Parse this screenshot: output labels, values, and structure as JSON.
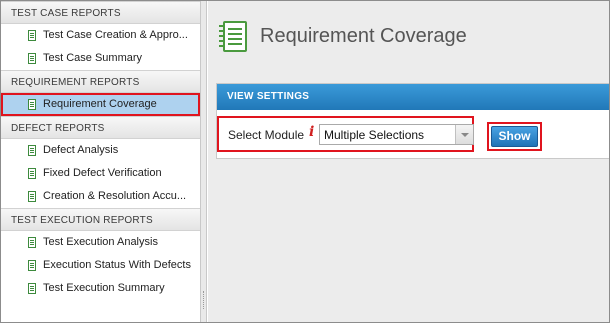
{
  "sidebar": {
    "sections": [
      {
        "title": "TEST CASE REPORTS",
        "items": [
          {
            "label": "Test Case Creation & Appro..."
          },
          {
            "label": "Test Case Summary"
          }
        ]
      },
      {
        "title": "REQUIREMENT REPORTS",
        "items": [
          {
            "label": "Requirement Coverage",
            "selected": true
          }
        ]
      },
      {
        "title": "DEFECT REPORTS",
        "items": [
          {
            "label": "Defect Analysis"
          },
          {
            "label": "Fixed Defect Verification"
          },
          {
            "label": "Creation & Resolution Accu..."
          }
        ]
      },
      {
        "title": "TEST EXECUTION REPORTS",
        "items": [
          {
            "label": "Test Execution Analysis"
          },
          {
            "label": "Execution Status With Defects"
          },
          {
            "label": "Test Execution Summary"
          }
        ]
      }
    ]
  },
  "main": {
    "page_title": "Requirement Coverage",
    "title_icon": "document-report-icon",
    "view_settings": {
      "header": "VIEW SETTINGS",
      "module_label": "Select Module",
      "required_marker": "i",
      "module_value": "Multiple Selections",
      "show_label": "Show"
    }
  },
  "colors": {
    "accent_blue": "#2a86c8",
    "highlight_red": "#e0141e",
    "selected_bg": "#aed2ef",
    "icon_green": "#3d8a3d"
  }
}
